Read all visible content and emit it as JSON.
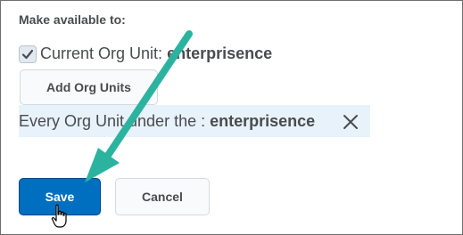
{
  "form": {
    "section_label": "Make available to:",
    "current_org_unit_label": "Current Org Unit:",
    "current_org_unit_value": "enterprisence",
    "current_org_unit_checked": true,
    "add_org_units_label": "Add Org Units",
    "org_row_prefix": "Every Org Unit under the :",
    "org_row_value": "enterprisence"
  },
  "actions": {
    "save_label": "Save",
    "cancel_label": "Cancel"
  },
  "colors": {
    "primary": "#006fbf",
    "annotation_arrow": "#2bb3a0",
    "selection_bg": "#e8f2fb"
  },
  "icons": {
    "checkbox": "checkmark-icon",
    "remove": "close-icon",
    "cursor": "hand-pointer-icon",
    "annotation": "arrow-annotation-icon"
  }
}
